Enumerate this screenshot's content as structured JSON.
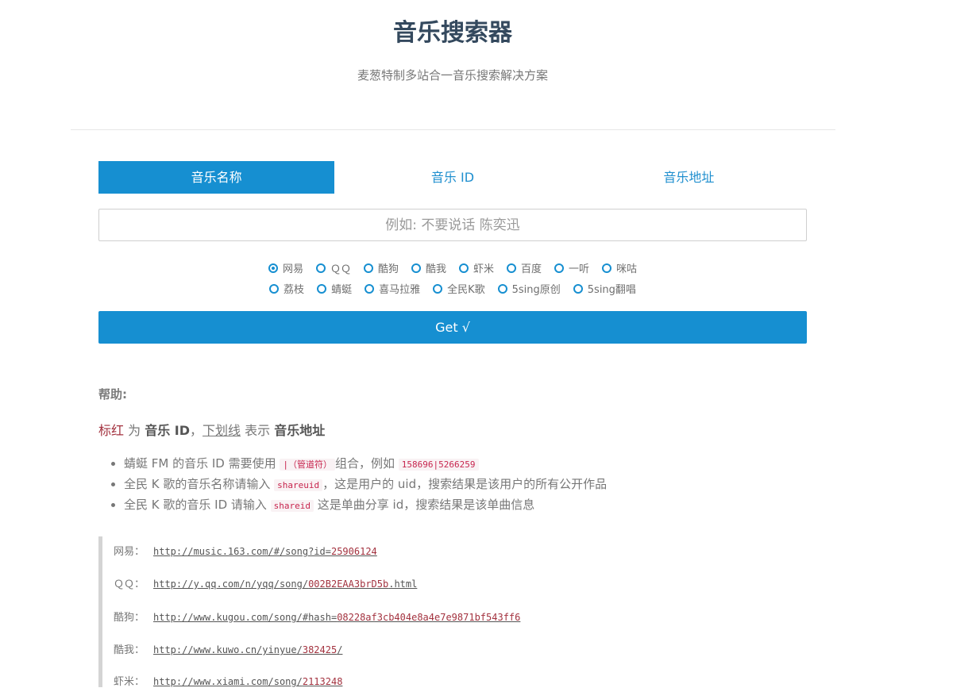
{
  "header": {
    "title": "音乐搜索器",
    "subtitle": "麦葱特制多站合一音乐搜索解决方案"
  },
  "tabs": [
    {
      "label": "音乐名称",
      "active": true
    },
    {
      "label": "音乐 ID",
      "active": false
    },
    {
      "label": "音乐地址",
      "active": false
    }
  ],
  "search": {
    "placeholder": "例如: 不要说话 陈奕迅",
    "value": ""
  },
  "sources_row1": [
    {
      "label": "网易",
      "checked": true
    },
    {
      "label": "ＱＱ",
      "checked": false
    },
    {
      "label": "酷狗",
      "checked": false
    },
    {
      "label": "酷我",
      "checked": false
    },
    {
      "label": "虾米",
      "checked": false
    },
    {
      "label": "百度",
      "checked": false
    },
    {
      "label": "一听",
      "checked": false
    },
    {
      "label": "咪咕",
      "checked": false
    }
  ],
  "sources_row2": [
    {
      "label": "荔枝",
      "checked": false
    },
    {
      "label": "蜻蜓",
      "checked": false
    },
    {
      "label": "喜马拉雅",
      "checked": false
    },
    {
      "label": "全民K歌",
      "checked": false
    },
    {
      "label": "5sing原创",
      "checked": false
    },
    {
      "label": "5sing翻唱",
      "checked": false
    }
  ],
  "get_button": "Get √",
  "help": {
    "title": "帮助:",
    "legend": {
      "red": "标红",
      "t1": " 为 ",
      "b1": "音乐 ID",
      "t2": "，",
      "underline": "下划线",
      "t3": " 表示 ",
      "b2": "音乐地址"
    },
    "items": [
      {
        "pre": "蜻蜓 FM 的音乐 ID 需要使用 ",
        "code1": "|（管道符）",
        "mid": "组合，例如 ",
        "code2": "158696|5266259",
        "post": ""
      },
      {
        "pre": "全民 K 歌的音乐名称请输入 ",
        "code1": "shareuid",
        "mid": "，这是用户的 uid，搜索结果是该用户的所有公开作品",
        "code2": "",
        "post": ""
      },
      {
        "pre": "全民 K 歌的音乐 ID 请输入 ",
        "code1": "shareid",
        "mid": " 这是单曲分享 id，搜索结果是该单曲信息",
        "code2": "",
        "post": ""
      }
    ]
  },
  "examples": [
    {
      "label": "网易：",
      "base": "http://music.163.com/#/song?id=",
      "id": "25906124",
      "suffix": ""
    },
    {
      "label": "ＱＱ：",
      "base": "http://y.qq.com/n/yqq/song/",
      "id": "002B2EAA3brD5b",
      "suffix": ".html"
    },
    {
      "label": "酷狗：",
      "base": "http://www.kugou.com/song/#hash=",
      "id": "08228af3cb404e8a4e7e9871bf543ff6",
      "suffix": ""
    },
    {
      "label": "酷我：",
      "base": "http://www.kuwo.cn/yinyue/",
      "id": "382425",
      "suffix": "/"
    },
    {
      "label": "虾米：",
      "base": "http://www.xiami.com/song/",
      "id": "2113248",
      "suffix": ""
    }
  ],
  "colors": {
    "accent": "#168fd1",
    "id_red": "#a3323f",
    "title": "#34495e"
  }
}
